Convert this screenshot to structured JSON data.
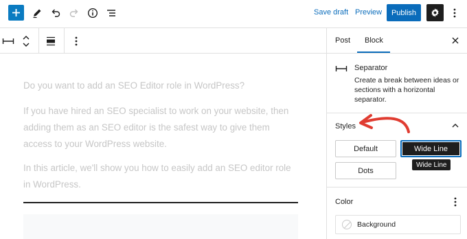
{
  "toolbar": {
    "save_draft": "Save draft",
    "preview": "Preview",
    "publish": "Publish",
    "icons": [
      "plus-icon",
      "pencil-icon",
      "undo-icon",
      "redo-icon",
      "info-icon",
      "list-view-icon",
      "gear-icon",
      "more-vertical-icon"
    ]
  },
  "block_toolbar": {
    "icons": [
      "separator-icon",
      "move-arrows-icon",
      "align-icon",
      "more-vertical-icon"
    ]
  },
  "content": {
    "paragraphs": [
      "Do you want to add an SEO Editor role in WordPress?",
      "If you have hired an SEO specialist to work on your website, then adding them as an SEO editor is the safest way to give them access to your WordPress website.",
      "In this article, we'll show you how to easily add an SEO editor role in WordPress."
    ]
  },
  "sidebar": {
    "tabs": [
      "Post",
      "Block"
    ],
    "active_tab": "Block",
    "block": {
      "title": "Separator",
      "description": "Create a break between ideas or sections with a horizontal separator."
    },
    "styles": {
      "title": "Styles",
      "options": [
        "Default",
        "Wide Line",
        "Dots"
      ],
      "selected": "Wide Line",
      "tooltip": "Wide Line"
    },
    "color": {
      "title": "Color",
      "item_label": "Background"
    }
  },
  "colors": {
    "accent": "#0a6cbb",
    "dark": "#1e1e1e",
    "annotation": "#e03c31"
  }
}
